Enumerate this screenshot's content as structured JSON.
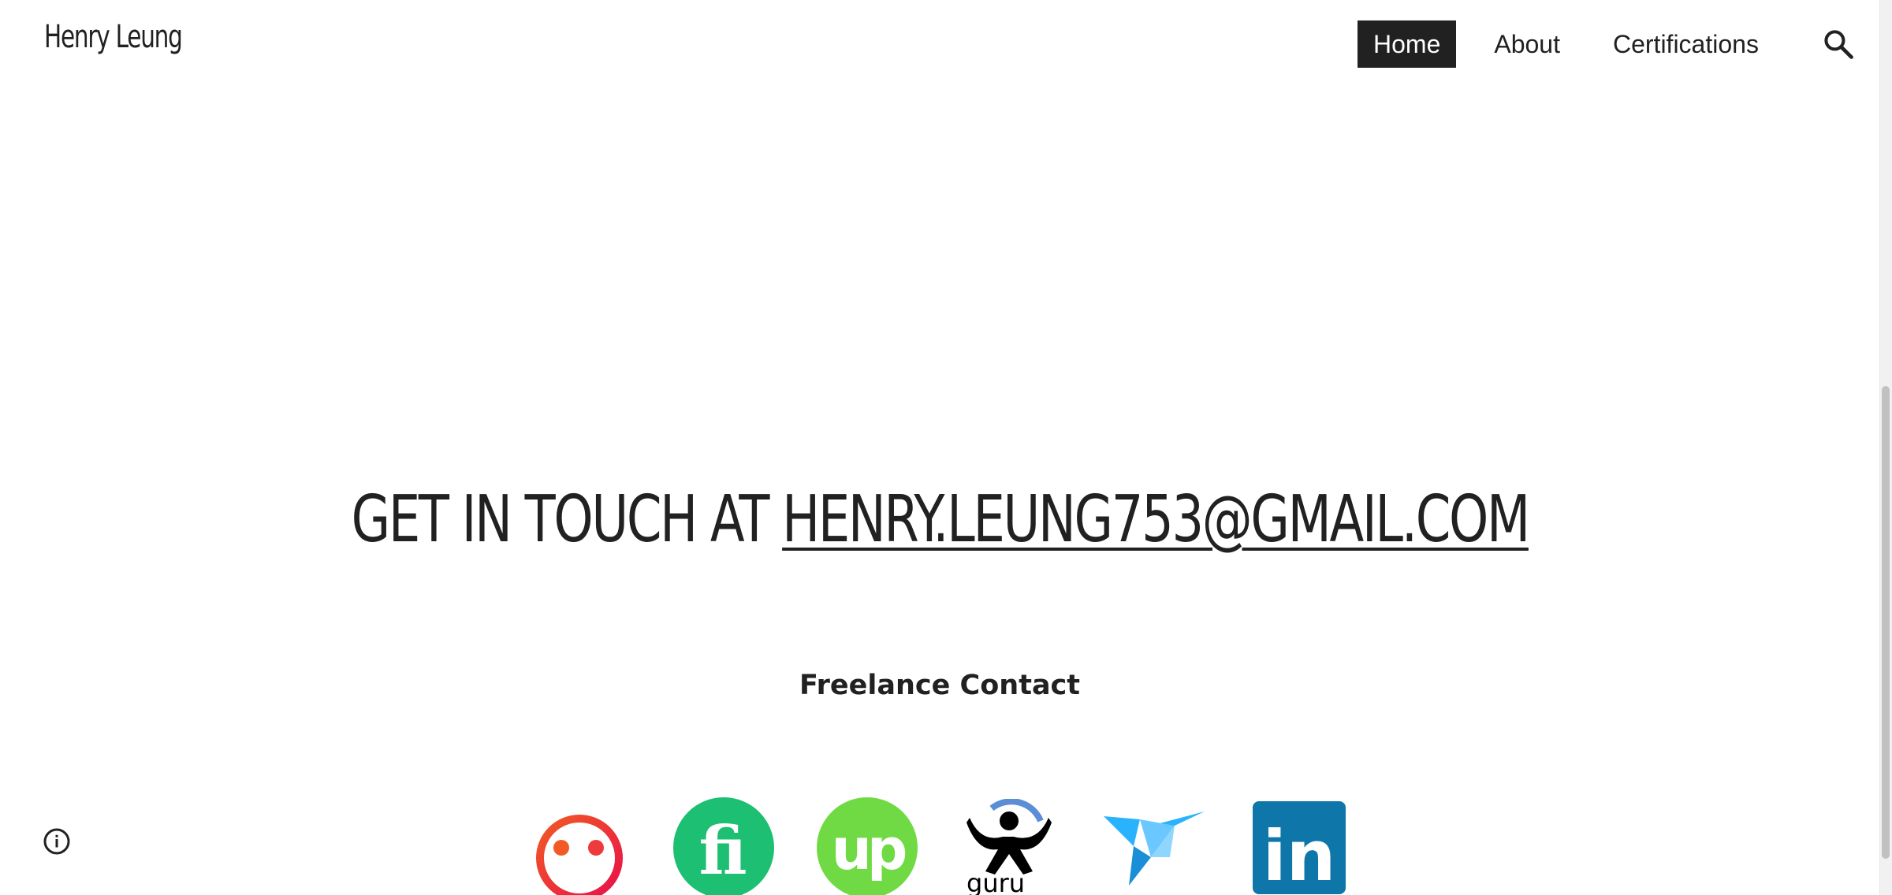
{
  "header": {
    "site_title": "Henry Leung",
    "nav": [
      {
        "label": "Home",
        "active": true
      },
      {
        "label": "About",
        "active": false
      },
      {
        "label": "Certifications",
        "active": false
      }
    ]
  },
  "main": {
    "headline_prefix": "GET IN TOUCH AT ",
    "headline_email": "HENRY.LEUNG753@GMAIL.COM",
    "subheading": "Freelance Contact",
    "logos": [
      {
        "name": "peopleperhour-logo",
        "color": "#ef4d2e"
      },
      {
        "name": "fiverr-logo",
        "color": "#1dbf73",
        "text": "fi"
      },
      {
        "name": "upwork-logo",
        "color": "#6fda44",
        "text": "up"
      },
      {
        "name": "guru-logo",
        "color": "#000000",
        "text": "guru"
      },
      {
        "name": "freelancer-logo",
        "color": "#29b2fe"
      },
      {
        "name": "linkedin-logo",
        "color": "#0e76a8",
        "text": "in"
      }
    ]
  },
  "icons": {
    "search": "search-icon",
    "info": "info-icon"
  }
}
